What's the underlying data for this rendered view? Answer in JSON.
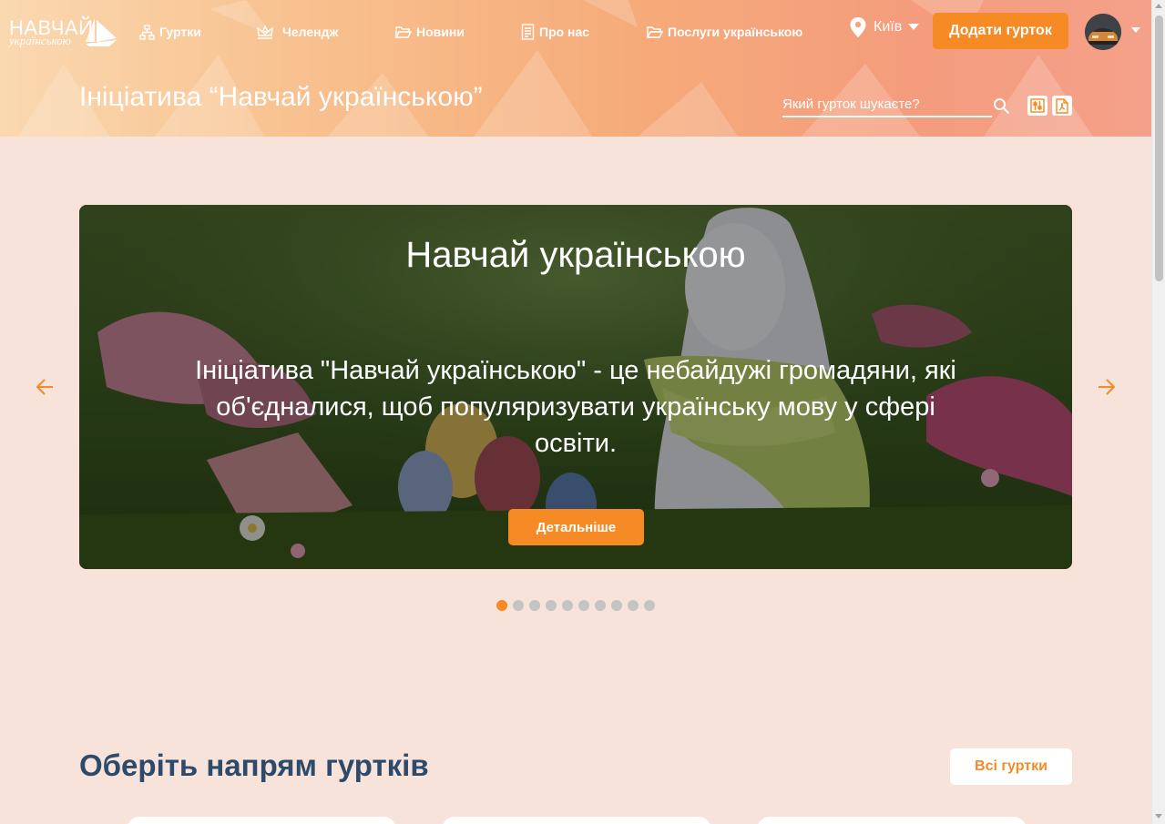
{
  "logo": {
    "line1": "НАВЧАЙ",
    "line2": "українською"
  },
  "nav": {
    "items": [
      {
        "label": "Гуртки",
        "icon": "sitemap-icon"
      },
      {
        "label": "Челендж",
        "icon": "crown-icon"
      },
      {
        "label": "Новини",
        "icon": "folder-open-icon"
      },
      {
        "label": "Про нас",
        "icon": "document-icon"
      },
      {
        "label": "Послуги українською",
        "icon": "folder-open-icon"
      }
    ]
  },
  "city": {
    "label": "Київ",
    "icon": "map-pin-icon"
  },
  "add_button": "Додати гурток",
  "header": {
    "title": "Ініціатива “Навчай українською”",
    "search_placeholder": "Який гурток шукаєте?"
  },
  "carousel": {
    "title": "Навчай українською",
    "text": "Ініціатива \"Навчай українською\" - це небайдужі громадяни, які об'єдналися, щоб популяризувати українську мову у сфері освіти.",
    "button": "Детальніше",
    "slide_count": 10,
    "active_slide": 1
  },
  "section": {
    "title": "Оберіть напрям гуртків",
    "all_button": "Всі гуртки"
  },
  "colors": {
    "accent": "#f68a24",
    "heading": "#2d4a6b",
    "page_bg": "#f8e3da"
  }
}
